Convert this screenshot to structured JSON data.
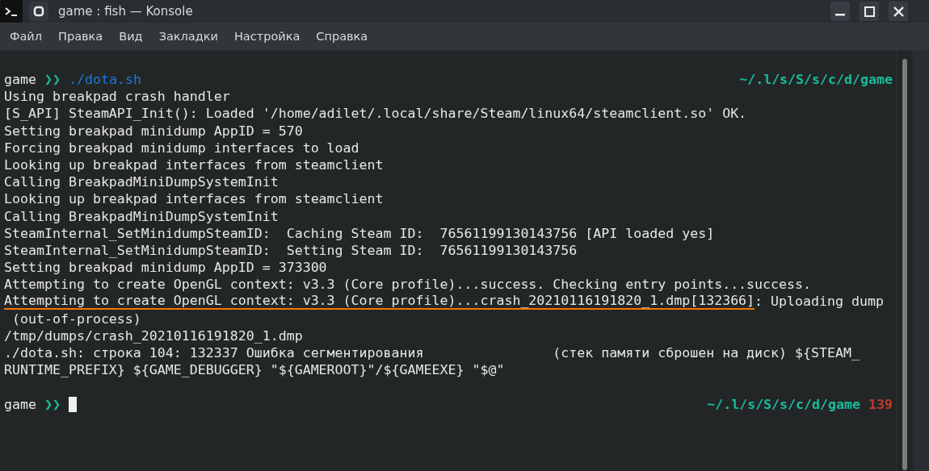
{
  "window": {
    "title": "game : fish — Konsole"
  },
  "menu": [
    "Файл",
    "Правка",
    "Вид",
    "Закладки",
    "Настройка",
    "Справка"
  ],
  "terminal": {
    "lines": [
      {
        "kind": "prompt",
        "user": "game",
        "arrow": "❯❯",
        "command": "./dota.sh",
        "path": "~/.l/s/S/s/c/d/game",
        "cursor": false
      },
      {
        "kind": "output",
        "text": "Using breakpad crash handler"
      },
      {
        "kind": "output",
        "text": "[S_API] SteamAPI_Init(): Loaded '/home/adilet/.local/share/Steam/linux64/steamclient.so' OK."
      },
      {
        "kind": "output",
        "text": "Setting breakpad minidump AppID = 570"
      },
      {
        "kind": "output",
        "text": "Forcing breakpad minidump interfaces to load"
      },
      {
        "kind": "output",
        "text": "Looking up breakpad interfaces from steamclient"
      },
      {
        "kind": "output",
        "text": "Calling BreakpadMiniDumpSystemInit"
      },
      {
        "kind": "output",
        "text": "Looking up breakpad interfaces from steamclient"
      },
      {
        "kind": "output",
        "text": "Calling BreakpadMiniDumpSystemInit"
      },
      {
        "kind": "output",
        "text": "SteamInternal_SetMinidumpSteamID:  Caching Steam ID:  76561199130143756 [API loaded yes]"
      },
      {
        "kind": "output",
        "text": "SteamInternal_SetMinidumpSteamID:  Setting Steam ID:  76561199130143756"
      },
      {
        "kind": "output",
        "text": "Setting breakpad minidump AppID = 373300"
      },
      {
        "kind": "output",
        "text": "Attempting to create OpenGL context: v3.3 (Core profile)...success. Checking entry points...success."
      },
      {
        "kind": "marked",
        "marked": "Attempting to create OpenGL context: v3.3 (Core profile)...crash_20210116191820_1.dmp[132366]",
        "text": ": Uploading dump"
      },
      {
        "kind": "output",
        "text": " (out-of-process)"
      },
      {
        "kind": "output",
        "text": "/tmp/dumps/crash_20210116191820_1.dmp"
      },
      {
        "kind": "output",
        "text": "./dota.sh: строка 104: 132337 Ошибка сегментирования                (стек памяти сброшен на диск) ${STEAM_"
      },
      {
        "kind": "output",
        "text": "RUNTIME_PREFIX} ${GAME_DEBUGGER} \"${GAMEROOT}\"/${GAMEEXE} \"$@\""
      },
      {
        "kind": "blank"
      },
      {
        "kind": "prompt",
        "user": "game",
        "arrow": "❯❯",
        "path": "~/.l/s/S/s/c/d/game",
        "status": "139",
        "cursor": true
      }
    ]
  }
}
